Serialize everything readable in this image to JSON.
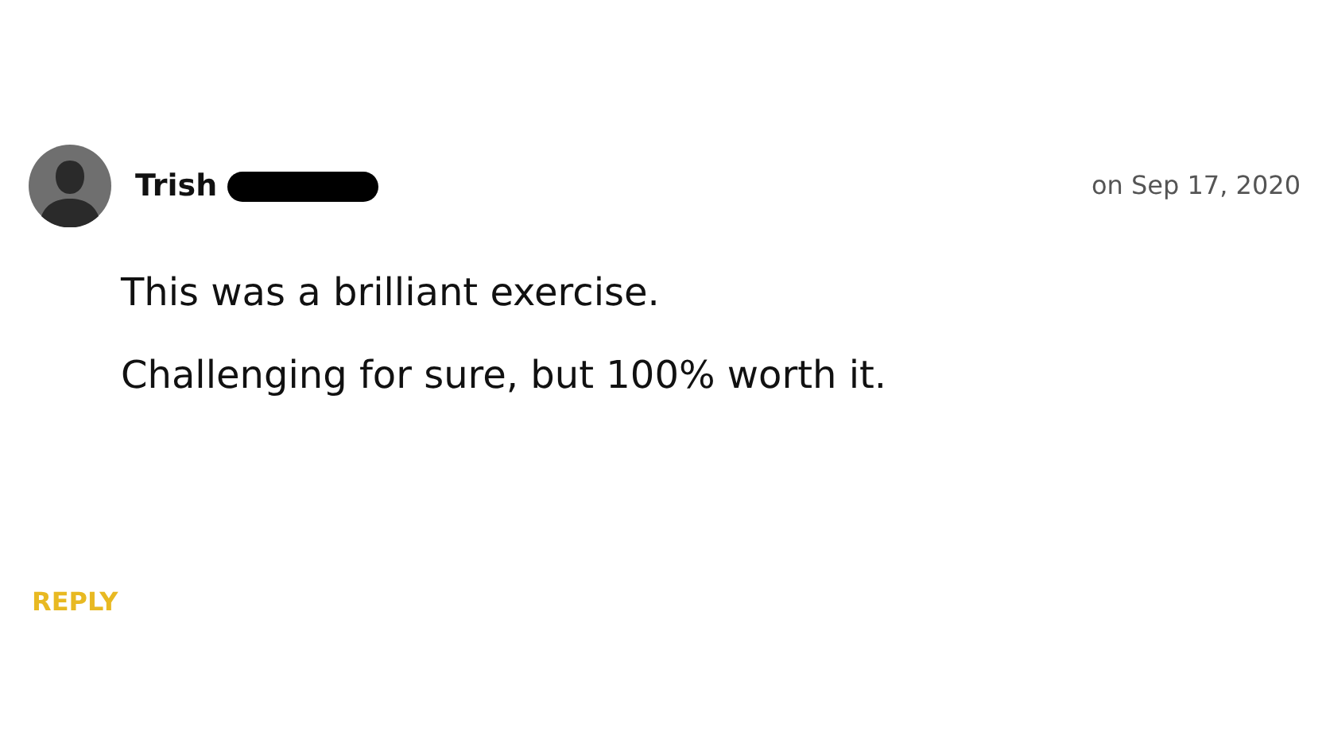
{
  "comment": {
    "author": "Trish",
    "author_redacted": true,
    "date": "on Sep 17, 2020",
    "paragraphs": [
      "This was a brilliant exercise.",
      "Challenging for sure, but 100% worth it."
    ],
    "reply_label": "REPLY"
  }
}
